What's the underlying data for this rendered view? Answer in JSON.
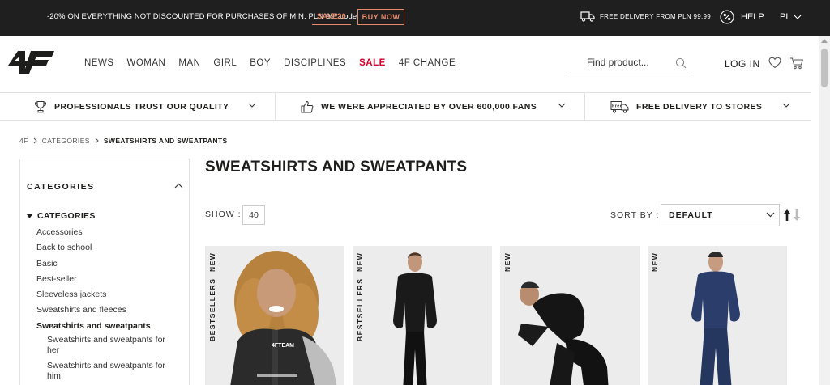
{
  "promo": {
    "text": "-20% ON EVERYTHING NOT DISCOUNTED FOR PURCHASES OF MIN. PLN 99* code:",
    "code": "SAVE20",
    "button": "BUY NOW",
    "delivery": "FREE DELIVERY FROM PLN 99.99",
    "help": "HELP",
    "language": "PL",
    "icons": [
      "truck-icon",
      "percent-icon",
      "chevron-down-icon"
    ]
  },
  "header": {
    "logo": "4F",
    "nav": [
      "NEWS",
      "WOMAN",
      "MAN",
      "GIRL",
      "BOY",
      "DISCIPLINES",
      "SALE",
      "4F CHANGE"
    ],
    "search_placeholder": "Find product...",
    "login": "LOG IN"
  },
  "usp": [
    {
      "icon": "trophy-icon",
      "text": "PROFESSIONALS TRUST OUR QUALITY"
    },
    {
      "icon": "thumbs-up-icon",
      "text": "WE WERE APPRECIATED BY OVER 600,000 FANS"
    },
    {
      "icon": "free-delivery-icon",
      "text": "FREE DELIVERY TO STORES"
    }
  ],
  "breadcrumb": [
    "4F",
    "CATEGORIES",
    "SWEATSHIRTS AND SWEATPANTS"
  ],
  "sidebar": {
    "title": "CATEGORIES",
    "group": "CATEGORIES",
    "items": [
      "Accessories",
      "Back to school",
      "Basic",
      "Best-seller",
      "Sleeveless jackets",
      "Sweatshirts and fleeces",
      "Sweatshirts and sweatpants"
    ],
    "active_index": 6,
    "subitems": [
      "Sweatshirts and sweatpants for her",
      "Sweatshirts and sweatpants for him"
    ]
  },
  "main": {
    "title": "SWEATSHIRTS AND SWEATPANTS",
    "show_label": "SHOW :",
    "show_value": "40",
    "sort_label": "SORT BY :",
    "sort_value": "DEFAULT"
  },
  "products": [
    {
      "badges": [
        "NEW",
        "BESTSELLERS"
      ],
      "print": "4FTEAM"
    },
    {
      "badges": [
        "NEW",
        "BESTSELLERS"
      ]
    },
    {
      "badges": [
        "NEW"
      ]
    },
    {
      "badges": [
        "NEW"
      ]
    }
  ],
  "colors": {
    "promo_bg": "#1f1f1f",
    "accent": "#e88a6a",
    "sale": "#d4002a",
    "card_bg": "#ececec"
  }
}
